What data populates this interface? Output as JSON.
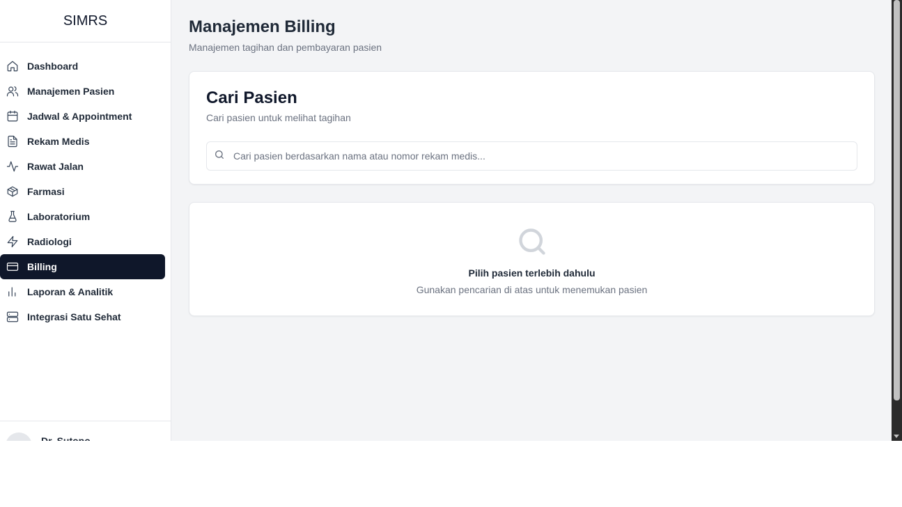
{
  "app": {
    "brand": "SIMRS"
  },
  "sidebar": {
    "items": [
      {
        "label": "Dashboard",
        "icon": "home-icon",
        "active": false
      },
      {
        "label": "Manajemen Pasien",
        "icon": "users-icon",
        "active": false
      },
      {
        "label": "Jadwal & Appointment",
        "icon": "calendar-icon",
        "active": false
      },
      {
        "label": "Rekam Medis",
        "icon": "file-text-icon",
        "active": false
      },
      {
        "label": "Rawat Jalan",
        "icon": "activity-icon",
        "active": false
      },
      {
        "label": "Farmasi",
        "icon": "package-icon",
        "active": false
      },
      {
        "label": "Laboratorium",
        "icon": "flask-icon",
        "active": false
      },
      {
        "label": "Radiologi",
        "icon": "zap-icon",
        "active": false
      },
      {
        "label": "Billing",
        "icon": "credit-card-icon",
        "active": true
      },
      {
        "label": "Laporan & Analitik",
        "icon": "bar-chart-icon",
        "active": false
      },
      {
        "label": "Integrasi Satu Sehat",
        "icon": "server-icon",
        "active": false
      }
    ],
    "user": {
      "name": "Dr. Sutopo"
    }
  },
  "main": {
    "title": "Manajemen Billing",
    "subtitle": "Manajemen tagihan dan pembayaran pasien",
    "search_card": {
      "title": "Cari Pasien",
      "description": "Cari pasien untuk melihat tagihan",
      "placeholder": "Cari pasien berdasarkan nama atau nomor rekam medis...",
      "value": ""
    },
    "empty_state": {
      "icon": "search-icon",
      "title": "Pilih pasien terlebih dahulu",
      "description": "Gunakan pencarian di atas untuk menemukan pasien"
    }
  },
  "colors": {
    "active_nav_bg": "#0f172a",
    "page_bg": "#f3f4f6"
  }
}
